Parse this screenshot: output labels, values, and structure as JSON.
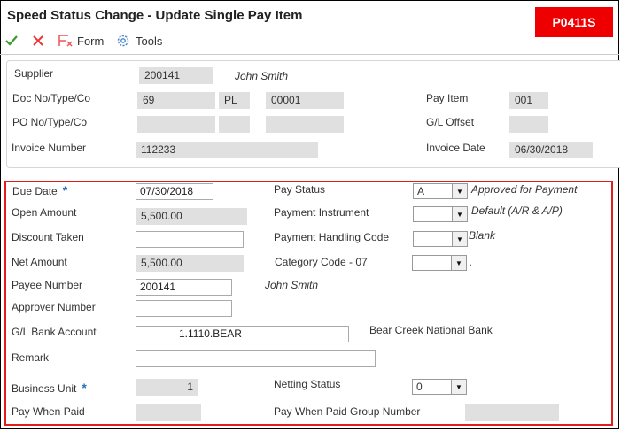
{
  "title": "Speed Status Change - Update Single Pay Item",
  "badge": "P0411S",
  "toolbar": {
    "form": "Form",
    "tools": "Tools"
  },
  "header": {
    "supplier_label": "Supplier",
    "supplier_value": "200141",
    "supplier_name": "John Smith",
    "doc_label": "Doc No/Type/Co",
    "doc_no": "69",
    "doc_type": "PL",
    "doc_co": "00001",
    "payitem_label": "Pay Item",
    "payitem_value": "001",
    "po_label": "PO No/Type/Co",
    "gl_offset_label": "G/L Offset",
    "invoice_number_label": "Invoice Number",
    "invoice_number_value": "112233",
    "invoice_date_label": "Invoice Date",
    "invoice_date_value": "06/30/2018"
  },
  "form": {
    "due_date_label": "Due Date",
    "due_date_value": "07/30/2018",
    "open_amount_label": "Open Amount",
    "open_amount_value": "5,500.00",
    "discount_taken_label": "Discount Taken",
    "discount_taken_value": "",
    "net_amount_label": "Net Amount",
    "net_amount_value": "5,500.00",
    "payee_label": "Payee Number",
    "payee_value": "200141",
    "payee_name": "John Smith",
    "approver_label": "Approver Number",
    "approver_value": "",
    "gl_bank_label": "G/L Bank Account",
    "gl_bank_value": "1.1110.BEAR",
    "gl_bank_desc": "Bear Creek National Bank",
    "remark_label": "Remark",
    "remark_value": "",
    "business_unit_label": "Business Unit",
    "business_unit_value": "1",
    "pay_when_paid_label": "Pay When Paid",
    "pay_status_label": "Pay Status",
    "pay_status_value": "A",
    "pay_status_desc": "Approved for Payment",
    "payment_instrument_label": "Payment Instrument",
    "payment_instrument_value": "",
    "payment_instrument_desc": "Default (A/R & A/P)",
    "payment_handling_label": "Payment Handling Code",
    "payment_handling_value": "",
    "payment_handling_desc": "Blank",
    "category_code_label": "Category Code - 07",
    "category_code_value": "",
    "category_code_desc": ".",
    "netting_status_label": "Netting Status",
    "netting_status_value": "0",
    "pwp_group_label": "Pay When Paid Group Number"
  },
  "colors": {
    "badge_bg": "#ee0000",
    "ok_icon": "#3a9a2a",
    "cancel_icon": "#e33",
    "highlight_border": "#e11d1d",
    "required_star": "#2a6ebd"
  },
  "icons": {
    "ok": "checkmark-icon",
    "cancel": "x-icon",
    "form": "form-icon",
    "tools": "gear-icon",
    "dropdown": "chevron-down-icon",
    "required": "asterisk-icon"
  }
}
